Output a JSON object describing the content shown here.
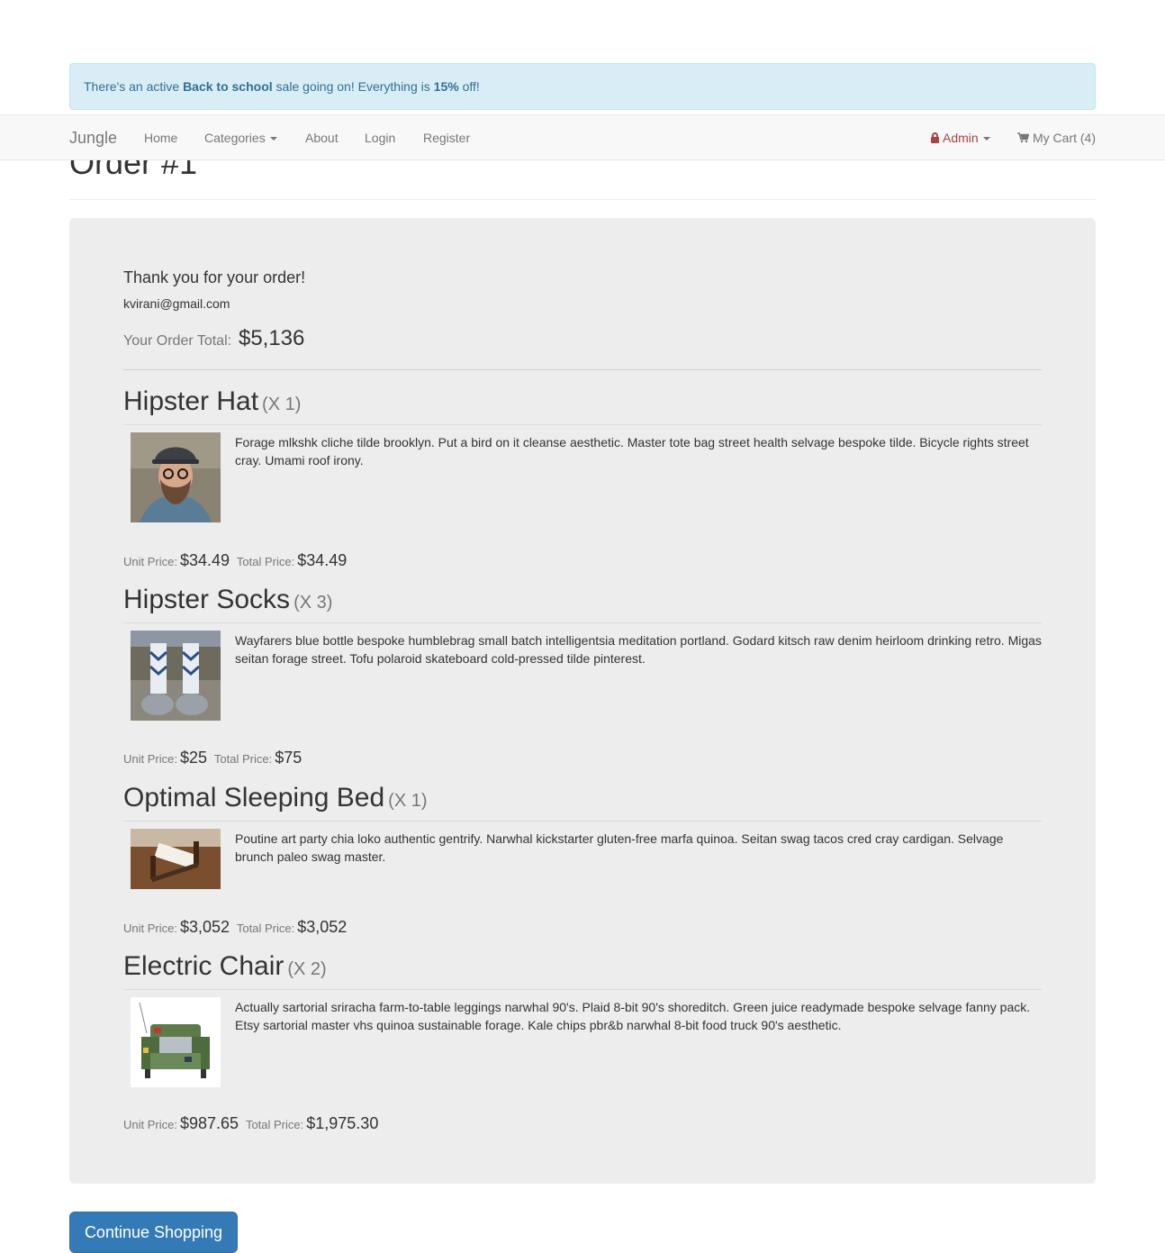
{
  "alert": {
    "prefix": "There's an active ",
    "sale_name": "Back to school",
    "middle": " sale going on! Everything is ",
    "discount": "15%",
    "suffix": " off!"
  },
  "nav": {
    "brand": "Jungle",
    "home": "Home",
    "categories": "Categories",
    "about": "About",
    "login": "Login",
    "register": "Register",
    "admin": "Admin",
    "cart": "My Cart (4)"
  },
  "page": {
    "title": "Order #1"
  },
  "order": {
    "thanks": "Thank you for your order!",
    "email": "kvirani@gmail.com",
    "total_label": "Your Order Total:",
    "total_value": "$5,136",
    "unit_label": "Unit Price:",
    "total_price_label": "Total Price:",
    "items": [
      {
        "name": "Hipster Hat",
        "qty": "(X 1)",
        "description": "Forage mlkshk cliche tilde brooklyn. Put a bird on it cleanse aesthetic. Master tote bag street health selvage bespoke tilde. Bicycle rights street cray. Umami roof irony.",
        "unit_price": "$34.49",
        "total_price": "$34.49"
      },
      {
        "name": "Hipster Socks",
        "qty": "(X 3)",
        "description": "Wayfarers blue bottle bespoke humblebrag small batch intelligentsia meditation portland. Godard kitsch raw denim heirloom drinking retro. Migas seitan forage street. Tofu polaroid skateboard cold-pressed tilde pinterest.",
        "unit_price": "$25",
        "total_price": "$75"
      },
      {
        "name": "Optimal Sleeping Bed",
        "qty": "(X 1)",
        "description": "Poutine art party chia loko authentic gentrify. Narwhal kickstarter gluten-free marfa quinoa. Seitan swag tacos cred cray cardigan. Selvage brunch paleo swag master.",
        "unit_price": "$3,052",
        "total_price": "$3,052"
      },
      {
        "name": "Electric Chair",
        "qty": "(X 2)",
        "description": "Actually sartorial sriracha farm-to-table leggings narwhal 90's. Plaid 8-bit 90's shoreditch. Green juice readymade bespoke selvage fanny pack. Etsy sartorial master vhs quinoa sustainable forage. Kale chips pbr&b narwhal 8-bit food truck 90's aesthetic.",
        "unit_price": "$987.65",
        "total_price": "$1,975.30"
      }
    ]
  },
  "actions": {
    "continue": "Continue Shopping"
  },
  "colors": {
    "alert_bg": "#d9edf7",
    "alert_text": "#31708f",
    "admin": "#a94442",
    "primary": "#337ab7",
    "panel_bg": "#ededed"
  }
}
